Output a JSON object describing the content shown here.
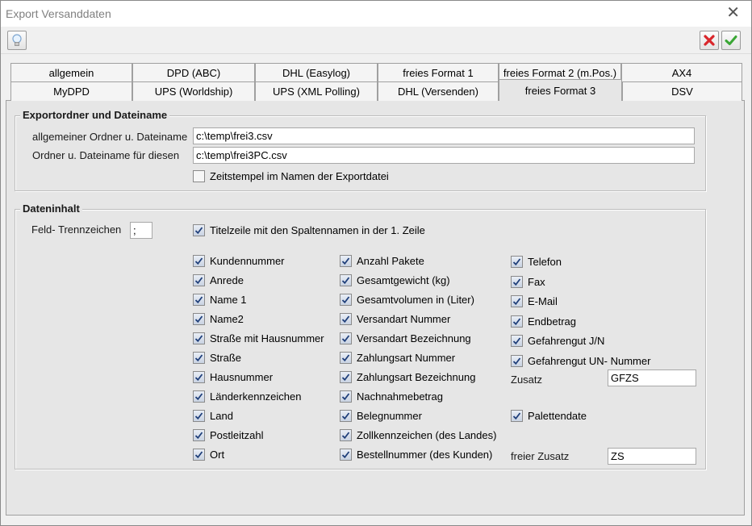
{
  "window": {
    "title": "Export Versanddaten"
  },
  "tabs_row1": [
    "allgemein",
    "DPD (ABC)",
    "DHL (Easylog)",
    "freies Format 1",
    "freies Format 2 (m.Pos.)",
    "AX4"
  ],
  "tabs_row2": [
    "MyDPD",
    "UPS (Worldship)",
    "UPS (XML Polling)",
    "DHL (Versenden)",
    "freies Format 3",
    "DSV"
  ],
  "active_tab": "freies Format 3",
  "export": {
    "group_title": "Exportordner und Dateiname",
    "label_general": "allgemeiner Ordner u. Dateiname",
    "value_general": "c:\\temp\\frei3.csv",
    "label_this": "Ordner u. Dateiname für diesen",
    "value_this": "c:\\temp\\frei3PC.csv",
    "timestamp_label": "Zeitstempel im Namen der Exportdatei",
    "timestamp_checked": false
  },
  "content": {
    "group_title": "Dateninhalt",
    "separator_label": "Feld- Trennzeichen",
    "separator_value": ";",
    "header_row_label": "Titelzeile mit den Spaltennamen in der 1. Zeile",
    "col1": [
      "Kundennummer",
      "Anrede",
      "Name 1",
      "Name2",
      "Straße mit Hausnummer",
      "Straße",
      "Hausnummer",
      "Länderkennzeichen",
      "Land",
      "Postleitzahl",
      "Ort"
    ],
    "col2": [
      "Anzahl Pakete",
      "Gesamtgewicht (kg)",
      "Gesamtvolumen in (Liter)",
      "Versandart Nummer",
      "Versandart Bezeichnung",
      "Zahlungsart Nummer",
      "Zahlungsart Bezeichnung",
      "Nachnahmebetrag",
      "Belegnummer",
      "Zollkennzeichen (des Landes)",
      "Bestellnummer (des Kunden)"
    ],
    "col3": [
      "Telefon",
      "Fax",
      "E-Mail",
      "Endbetrag",
      "Gefahrengut J/N",
      "Gefahrengut UN- Nummer"
    ],
    "zusatz_label": "Zusatz",
    "zusatz_value": "GFZS",
    "palettendate_label": "Palettendate",
    "freier_zusatz_label": "freier Zusatz",
    "freier_zusatz_value": "ZS"
  },
  "colors": {
    "cancel": "#d9262b",
    "ok": "#3aa635",
    "group_border": "#bdbdbd"
  }
}
